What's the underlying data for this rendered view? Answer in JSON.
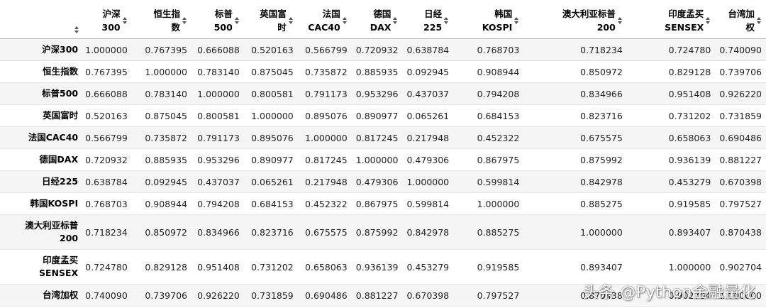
{
  "columns": [
    "沪深\n300",
    "恒生指\n数",
    "标普\n500",
    "英国富\n时",
    "法国\nCAC40",
    "德国\nDAX",
    "日经\n225",
    "韩国\nKOSPI",
    "澳大利亚标普\n200",
    "印度孟买\nSENSEX",
    "台湾加\n权"
  ],
  "rows": [
    {
      "label": "沪深300",
      "values": [
        "1.000000",
        "0.767395",
        "0.666088",
        "0.520163",
        "0.566799",
        "0.720932",
        "0.638784",
        "0.768703",
        "0.718234",
        "0.724780",
        "0.740090"
      ]
    },
    {
      "label": "恒生指数",
      "values": [
        "0.767395",
        "1.000000",
        "0.783140",
        "0.875045",
        "0.735872",
        "0.885935",
        "0.092945",
        "0.908944",
        "0.850972",
        "0.829128",
        "0.739706"
      ]
    },
    {
      "label": "标普500",
      "values": [
        "0.666088",
        "0.783140",
        "1.000000",
        "0.800581",
        "0.791173",
        "0.953296",
        "0.437037",
        "0.794208",
        "0.834966",
        "0.951408",
        "0.926220"
      ]
    },
    {
      "label": "英国富时",
      "values": [
        "0.520163",
        "0.875045",
        "0.800581",
        "1.000000",
        "0.895076",
        "0.890977",
        "0.065261",
        "0.684153",
        "0.823716",
        "0.731202",
        "0.731859"
      ]
    },
    {
      "label": "法国CAC40",
      "values": [
        "0.566799",
        "0.735872",
        "0.791173",
        "0.895076",
        "1.000000",
        "0.817245",
        "0.217948",
        "0.452322",
        "0.675575",
        "0.658063",
        "0.690486"
      ]
    },
    {
      "label": "德国DAX",
      "values": [
        "0.720932",
        "0.885935",
        "0.953296",
        "0.890977",
        "0.817245",
        "1.000000",
        "0.479306",
        "0.867975",
        "0.875992",
        "0.936139",
        "0.881227"
      ]
    },
    {
      "label": "日经225",
      "values": [
        "0.638784",
        "0.092945",
        "0.437037",
        "0.065261",
        "0.217948",
        "0.479306",
        "1.000000",
        "0.599814",
        "0.842978",
        "0.453279",
        "0.670398"
      ]
    },
    {
      "label": "韩国KOSPI",
      "values": [
        "0.768703",
        "0.908944",
        "0.794208",
        "0.684153",
        "0.452322",
        "0.867975",
        "0.599814",
        "1.000000",
        "0.885275",
        "0.919585",
        "0.797527"
      ]
    },
    {
      "label": "澳大利亚标普\n200",
      "values": [
        "0.718234",
        "0.850972",
        "0.834966",
        "0.823716",
        "0.675575",
        "0.875992",
        "0.842978",
        "0.885275",
        "1.000000",
        "0.893407",
        "0.870438"
      ]
    },
    {
      "label": "印度孟买\nSENSEX",
      "values": [
        "0.724780",
        "0.829128",
        "0.951408",
        "0.731202",
        "0.658063",
        "0.936139",
        "0.453279",
        "0.919585",
        "0.893407",
        "1.000000",
        "0.902704"
      ]
    },
    {
      "label": "台湾加权",
      "values": [
        "0.740090",
        "0.739706",
        "0.926220",
        "0.731859",
        "0.690486",
        "0.881227",
        "0.670398",
        "0.797527",
        "0.870438",
        "0.902704",
        "1.000000"
      ]
    }
  ],
  "watermark": "头条 @Python金融量化",
  "colors": {
    "stripe": "#f5f5f5",
    "background": "#ffffff",
    "header_border": "#b8b8b8"
  },
  "icons": {
    "sort": "sort-icon"
  }
}
